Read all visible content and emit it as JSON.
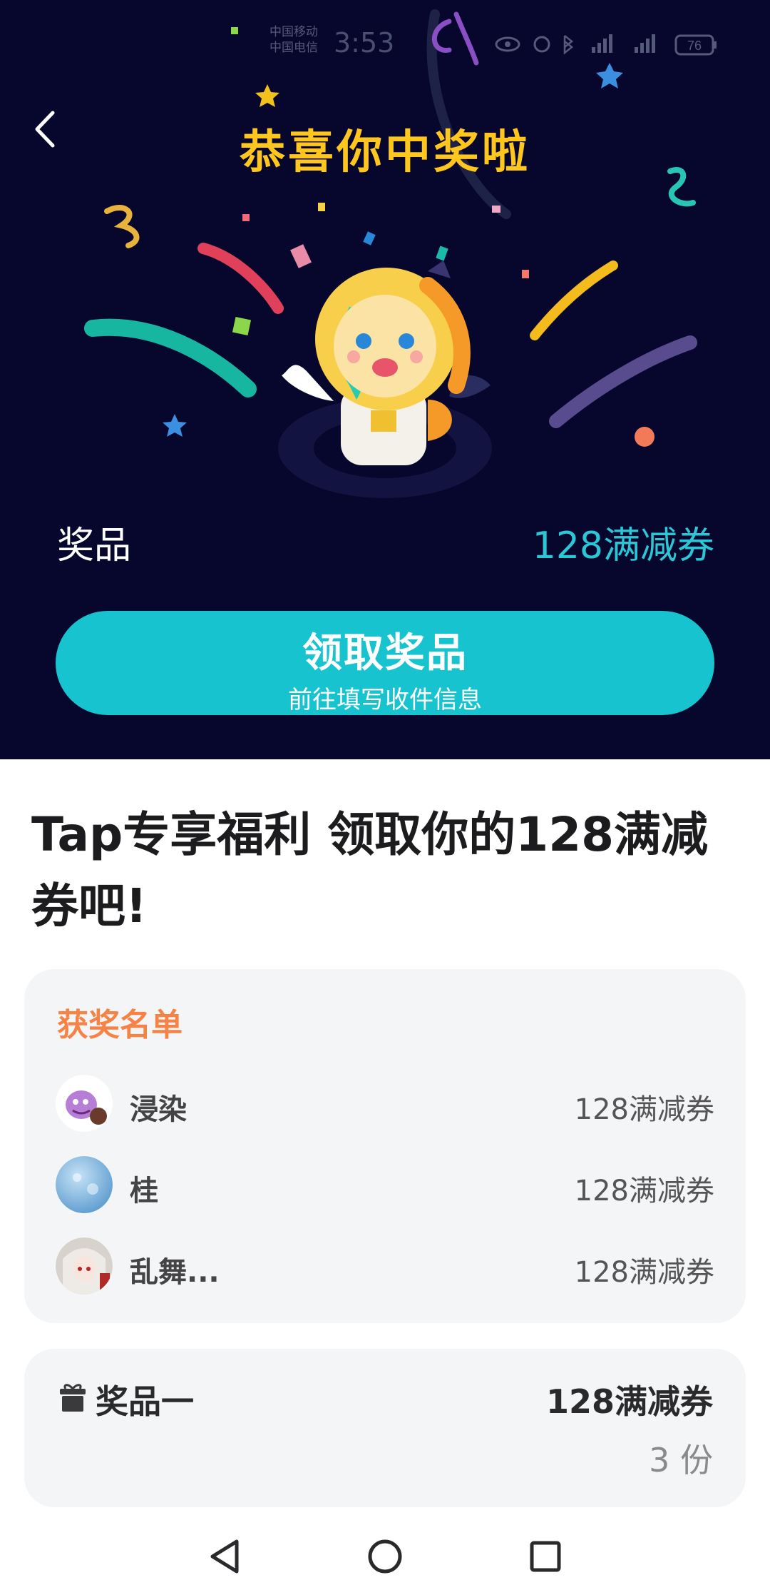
{
  "status_bar": {
    "carrier": "中国移动 中国电信",
    "time": "3:53",
    "battery": "76"
  },
  "hero": {
    "title": "恭喜你中奖啦",
    "prize_label": "奖品",
    "prize_value": "128满减券",
    "claim_button": {
      "label": "领取奖品",
      "sub_label": "前往填写收件信息"
    }
  },
  "headline": "Tap专享福利 领取你的128满减券吧!",
  "winners": {
    "title": "获奖名单",
    "rows": [
      {
        "name": "浸染",
        "prize": "128满减券",
        "avatar": "cartoon-avatar"
      },
      {
        "name": "桂",
        "prize": "128满减券",
        "avatar": "sky-avatar"
      },
      {
        "name": "乱舞...",
        "prize": "128满减券",
        "avatar": "anime-avatar"
      }
    ]
  },
  "prize_detail": {
    "icon": "gift-icon",
    "label": "奖品一",
    "value": "128满减券",
    "count": "3 份"
  },
  "colors": {
    "hero_bg": "#07072d",
    "title_yellow": "#ffc71e",
    "accent_teal": "#16c3ce",
    "winners_title": "#f58346"
  }
}
